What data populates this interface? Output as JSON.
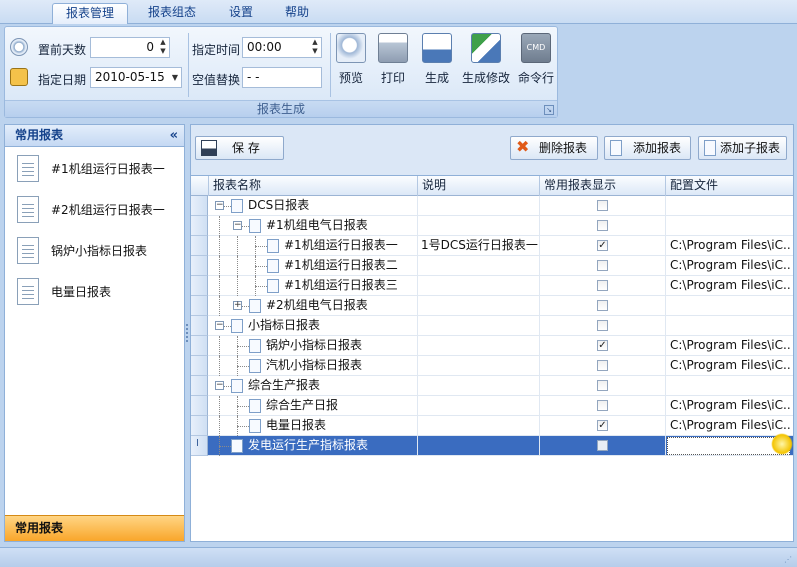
{
  "tabs": [
    {
      "label": "报表管理",
      "active": true
    },
    {
      "label": "报表组态",
      "active": false
    },
    {
      "label": "设置",
      "active": false
    },
    {
      "label": "帮助",
      "active": false
    }
  ],
  "ribbon": {
    "group_label": "报表生成",
    "days_before_label": "置前天数",
    "days_before_value": "0",
    "date_label": "指定日期",
    "date_value": "2010-05-15",
    "time_label": "指定时间",
    "time_value": "00:00",
    "null_replace_label": "空值替换",
    "null_replace_value": "- -",
    "buttons": [
      {
        "label": "预览",
        "icon": "preview-icon"
      },
      {
        "label": "打印",
        "icon": "printer-icon"
      },
      {
        "label": "生成",
        "icon": "save-generate-icon"
      },
      {
        "label": "生成修改",
        "icon": "generate-edit-icon"
      },
      {
        "label": "命令行",
        "icon": "cmd-icon",
        "icon_text": "CMD"
      }
    ]
  },
  "left_panel": {
    "title": "常用报表",
    "collapse_glyph": "«",
    "items": [
      {
        "label": "#1机组运行日报表一"
      },
      {
        "label": "#2机组运行日报表一"
      },
      {
        "label": "锅炉小指标日报表"
      },
      {
        "label": "电量日报表"
      }
    ],
    "footer": "常用报表"
  },
  "toolbar": {
    "save_label": "保  存",
    "delete_label": "删除报表",
    "add_label": "添加报表",
    "add_child_label": "添加子报表"
  },
  "grid": {
    "columns": [
      "报表名称",
      "说明",
      "常用报表显示",
      "配置文件"
    ],
    "rows": [
      {
        "name": "DCS日报表",
        "level": 0,
        "expander": "−",
        "desc": "",
        "checked": false,
        "config": ""
      },
      {
        "name": "#1机组电气日报表",
        "level": 1,
        "expander": "−",
        "desc": "",
        "checked": false,
        "config": ""
      },
      {
        "name": "#1机组运行日报表一",
        "level": 2,
        "expander": "",
        "desc": "1号DCS运行日报表一",
        "checked": true,
        "config": "C:\\Program Files\\iC..."
      },
      {
        "name": "#1机组运行日报表二",
        "level": 2,
        "expander": "",
        "desc": "",
        "checked": false,
        "config": "C:\\Program Files\\iC..."
      },
      {
        "name": "#1机组运行日报表三",
        "level": 2,
        "expander": "",
        "desc": "",
        "checked": false,
        "config": "C:\\Program Files\\iC..."
      },
      {
        "name": "#2机组电气日报表",
        "level": 1,
        "expander": "+",
        "desc": "",
        "checked": false,
        "config": ""
      },
      {
        "name": "小指标日报表",
        "level": 0,
        "expander": "−",
        "desc": "",
        "checked": false,
        "config": ""
      },
      {
        "name": "锅炉小指标日报表",
        "level": 1,
        "expander": "",
        "desc": "",
        "checked": true,
        "config": "C:\\Program Files\\iC..."
      },
      {
        "name": "汽机小指标日报表",
        "level": 1,
        "expander": "",
        "desc": "",
        "checked": false,
        "config": "C:\\Program Files\\iC..."
      },
      {
        "name": "综合生产报表",
        "level": 0,
        "expander": "−",
        "desc": "",
        "checked": false,
        "config": ""
      },
      {
        "name": "综合生产日报",
        "level": 1,
        "expander": "",
        "desc": "",
        "checked": false,
        "config": "C:\\Program Files\\iC..."
      },
      {
        "name": "电量日报表",
        "level": 1,
        "expander": "",
        "desc": "",
        "checked": true,
        "config": "C:\\Program Files\\iC..."
      },
      {
        "name": "发电运行生产指标报表",
        "level": 0,
        "expander": "",
        "desc": "",
        "checked": false,
        "config": "",
        "selected": true
      }
    ]
  }
}
